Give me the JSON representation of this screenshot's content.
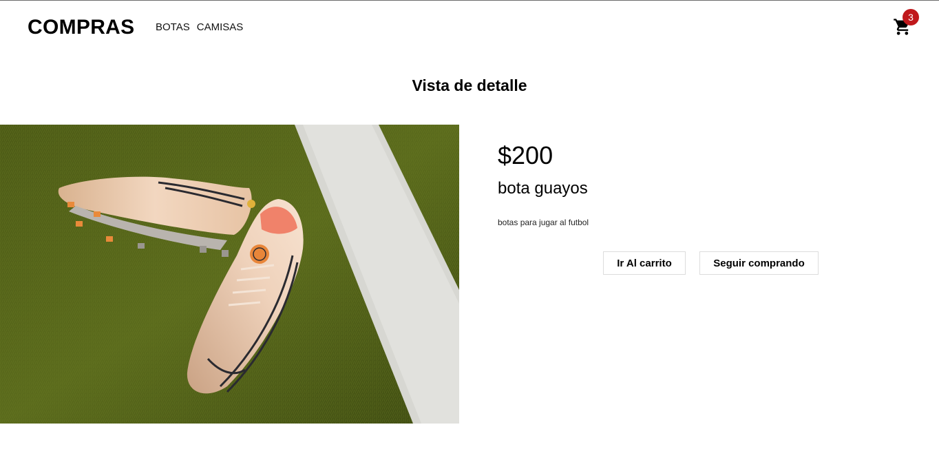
{
  "header": {
    "brand": "COMPRAS",
    "nav": [
      {
        "label": "BOTAS"
      },
      {
        "label": "CAMISAS"
      }
    ],
    "cart": {
      "icon": "cart-icon",
      "count": "3",
      "badge_color": "#c0181c"
    }
  },
  "main": {
    "title": "Vista de detalle",
    "product": {
      "image": "football-boots-on-grass-photo",
      "price": "$200",
      "name": "bota guayos",
      "description": "botas para jugar al futbol"
    },
    "actions": {
      "go_to_cart": "Ir Al carrito",
      "keep_shopping": "Seguir comprando"
    }
  }
}
